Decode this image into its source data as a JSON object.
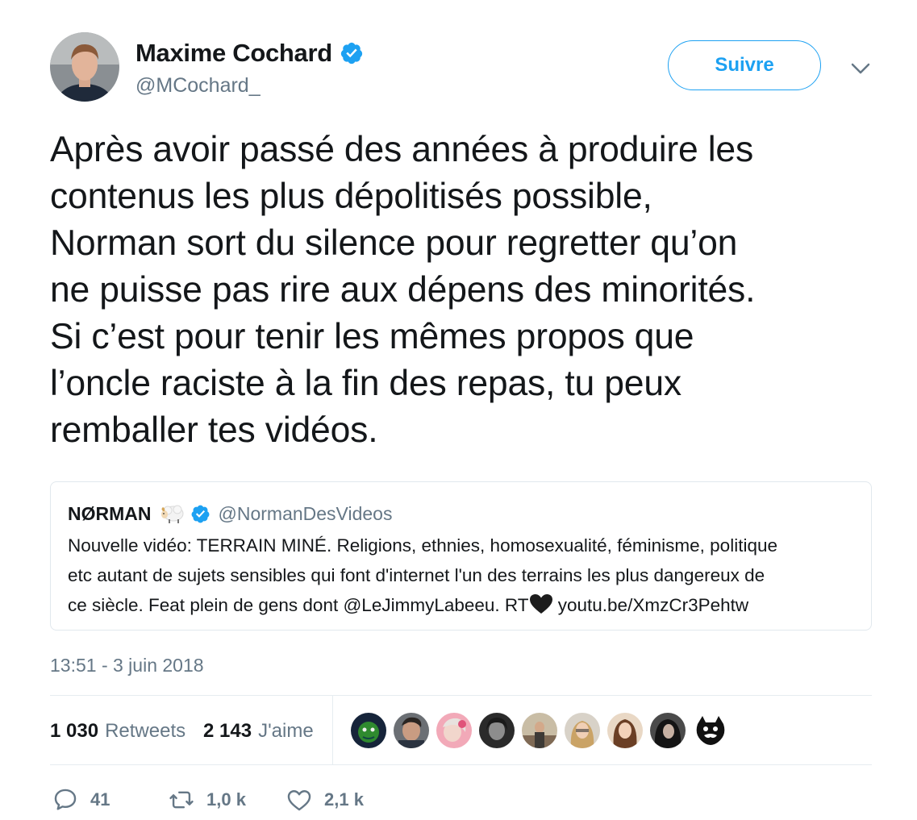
{
  "author": {
    "name": "Maxime Cochard",
    "handle": "@MCochard_"
  },
  "follow_label": "Suivre",
  "tweet_text": "Après avoir passé des années à produire les\ncontenus les plus dépolitisés possible,\nNorman sort du silence pour regretter qu’on\nne puisse pas rire aux dépens des minorités.\nSi c’est pour tenir les mêmes propos que\nl’oncle raciste à la fin des repas, tu peux\nremballer tes vidéos.",
  "quote": {
    "name": "NØRMAN",
    "handle": "@NormanDesVideos",
    "text_before_heart": "Nouvelle vidéo: TERRAIN MINÉ. Religions, ethnies, homosexualité, féminisme, politique\netc autant de sujets sensibles qui font d'internet l'un des terrains les plus dangereux de\nce siècle. Feat plein de gens dont @LeJimmyLabeeu. RT",
    "text_after_heart": " youtu.be/XmzCr3Pehtw"
  },
  "timestamp": "13:51 - 3 juin 2018",
  "stats": {
    "retweets_count": "1 030",
    "retweets_label": "Retweets",
    "likes_count": "2 143",
    "likes_label": "J'aime"
  },
  "actions": {
    "replies": "41",
    "retweets": "1,0 k",
    "likes": "2,1 k"
  },
  "colors": {
    "accent": "#1da1f2",
    "muted": "#657786",
    "text": "#14171a",
    "border": "#e1e8ed"
  },
  "icons": [
    "verified-badge-icon",
    "chevron-down-icon",
    "sheep-emoji-icon",
    "black-heart-emoji-icon",
    "reply-icon",
    "retweet-icon",
    "like-icon"
  ]
}
